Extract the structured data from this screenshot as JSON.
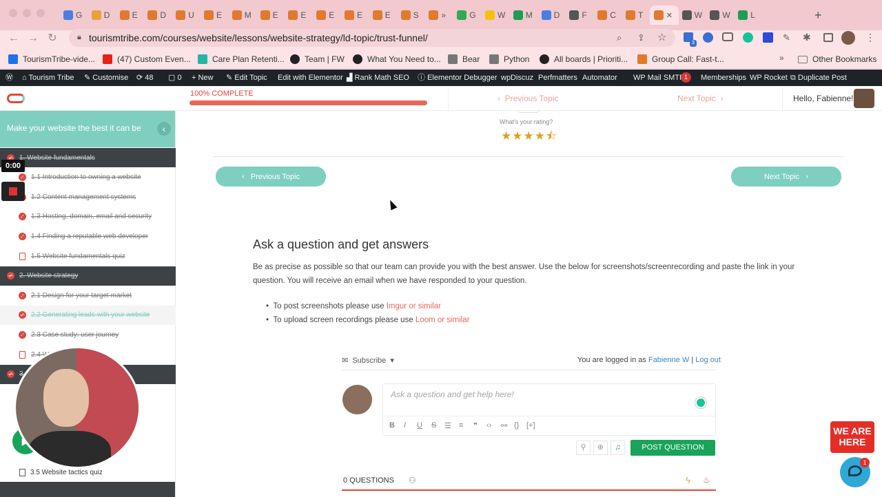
{
  "browser": {
    "url": "tourismtribe.com/courses/website/lessons/website-strategy/ld-topic/trust-funnel/",
    "tabs": [
      {
        "label": "G",
        "color": "#4a7fe0"
      },
      {
        "label": "D",
        "color": "#e8a23b"
      },
      {
        "label": "E",
        "color": "#e07a2f"
      },
      {
        "label": "D",
        "color": "#e07a2f"
      },
      {
        "label": "U",
        "color": "#e07a2f"
      },
      {
        "label": "E",
        "color": "#e07a2f"
      },
      {
        "label": "M",
        "color": "#e07a2f"
      },
      {
        "label": "E",
        "color": "#e07a2f"
      },
      {
        "label": "E",
        "color": "#e07a2f"
      },
      {
        "label": "E",
        "color": "#e07a2f"
      },
      {
        "label": "E",
        "color": "#e07a2f"
      },
      {
        "label": "E",
        "color": "#e07a2f"
      },
      {
        "label": "S",
        "color": "#e07a2f"
      },
      {
        "label": "»",
        "color": "#e07a2f"
      },
      {
        "label": "G",
        "color": "#34a853"
      },
      {
        "label": "W",
        "color": "#f4c20d"
      },
      {
        "label": "M",
        "color": "#1f9d55"
      },
      {
        "label": "D",
        "color": "#4a7fe0"
      },
      {
        "label": "F",
        "color": "#555555"
      },
      {
        "label": "C",
        "color": "#e07a2f"
      },
      {
        "label": "T",
        "color": "#e07a2f"
      },
      {
        "label": "",
        "color": "#e07a2f"
      },
      {
        "label": "W",
        "color": "#555555"
      },
      {
        "label": "W",
        "color": "#555555"
      },
      {
        "label": "L",
        "color": "#1f9d55"
      }
    ],
    "bookmarks": [
      {
        "label": "TourismTribe-vide...",
        "color": "#1a73e8"
      },
      {
        "label": "(47) Custom Even...",
        "color": "#e62117"
      },
      {
        "label": "Care Plan Retenti...",
        "color": "#26b5a5"
      },
      {
        "label": "Team | FW",
        "color": "#222222"
      },
      {
        "label": "What You Need to...",
        "color": "#222222"
      },
      {
        "label": "Bear",
        "color": "#777777"
      },
      {
        "label": "Python",
        "color": "#777777"
      },
      {
        "label": "All boards | Prioriti...",
        "color": "#222222"
      },
      {
        "label": "Group Call: Fast-t...",
        "color": "#e07a2f"
      }
    ],
    "other_bookmarks": "Other Bookmarks",
    "extension_badge": "3"
  },
  "adminbar": {
    "site": "Tourism Tribe",
    "customise": "Customise",
    "updates": "48",
    "comments": "0",
    "new": "New",
    "edit_topic": "Edit Topic",
    "elementor": "Edit with Elementor",
    "rankmath": "Rank Math SEO",
    "debugger": "Elementor Debugger",
    "wpdiscuz": "wpDiscuz",
    "perfmatters": "Perfmatters",
    "automator": "Automator",
    "smtp": "WP Mail SMTP",
    "smtp_badge": "1",
    "memberships": "Memberships",
    "rocket": "WP Rocket",
    "duplicate": "Duplicate Post"
  },
  "header": {
    "progress_label": "100% COMPLETE",
    "progress": 1.0,
    "prev_topic": "Previous Topic",
    "next_topic": "Next Topic",
    "greeting": "Hello, Fabienne!"
  },
  "sidebar": {
    "title": "Make your website the best it can be",
    "timer": "0:00",
    "rows": [
      {
        "label": "1. Website fundamentals",
        "kind": "section"
      },
      {
        "label": "1.1 Introduction to owning a website",
        "kind": "lesson"
      },
      {
        "label": "1.2 Content management systems",
        "kind": "lesson"
      },
      {
        "label": "1.3 Hosting, domain, email and security",
        "kind": "lesson"
      },
      {
        "label": "1.4 Finding a reputable web developer",
        "kind": "lesson"
      },
      {
        "label": "1.5 Website fundamentals quiz",
        "kind": "quiz"
      },
      {
        "label": "2. Website strategy",
        "kind": "section"
      },
      {
        "label": "2.1 Design for your target market",
        "kind": "lesson"
      },
      {
        "label": "2.2 Generating leads with your website",
        "kind": "active"
      },
      {
        "label": "2.3 Case study: user journey",
        "kind": "lesson"
      },
      {
        "label": "2.4 W",
        "kind": "quiz"
      },
      {
        "label": "3.",
        "kind": "section"
      }
    ],
    "bottom_item": "3.5 Website tactics quiz"
  },
  "main": {
    "rating_label": "What's your rating?",
    "rating": 4.5,
    "prev_btn": "Previous Topic",
    "next_btn": "Next Topic",
    "heading": "Ask a question and get answers",
    "intro": "Be as precise as possible so that our team can provide you with the best answer. Use the below for screenshots/screenrecording and paste the link in your question. You will receive an email when we have responded to your question.",
    "bullet1_text": "To post screenshots please use ",
    "bullet1_link": "Imgur or similar",
    "bullet2_text": "To upload screen recordings please use ",
    "bullet2_link": "Loom or similar",
    "subscribe": "Subscribe",
    "logged_in_text": "You are logged in as",
    "user_name": "Fabienne W",
    "separator": "|",
    "logout": "Log out",
    "placeholder": "Ask a question and get help here!",
    "post_btn": "POST QUESTION",
    "questions_count": "0 QUESTIONS"
  },
  "chat": {
    "badge_line1": "WE ARE",
    "badge_line2": "HERE",
    "unread": "1"
  },
  "colors": {
    "accent": "#e2453b",
    "teal": "#7fcfc0",
    "green": "#1aa35a",
    "dark": "#1d2327"
  }
}
